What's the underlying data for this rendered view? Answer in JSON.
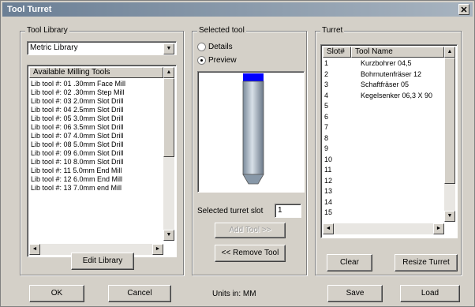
{
  "window": {
    "title": "Tool Turret",
    "close_glyph": "✕"
  },
  "library": {
    "group_title": "Tool Library",
    "selected_library": "Metric Library",
    "list_header": "Available Milling Tools",
    "items": [
      "Lib tool #: 01 .30mm Face Mill",
      "Lib tool #: 02 .30mm Step Mill",
      "Lib tool #: 03 2.0mm Slot Drill",
      "Lib tool #: 04 2.5mm Slot Drill",
      "Lib tool #: 05 3.0mm Slot Drill",
      "Lib tool #: 06 3.5mm Slot Drill",
      "Lib tool #: 07 4.0mm Slot Drill",
      "Lib tool #: 08 5.0mm Slot Drill",
      "Lib tool #: 09 6.0mm Slot Drill",
      "Lib tool #: 10 8.0mm Slot Drill",
      "Lib tool #: 11 5.0mm End Mill",
      "Lib tool #: 12 6.0mm End Mill",
      "Lib tool #: 13 7.0mm end Mill"
    ],
    "edit_button": "Edit Library"
  },
  "selected_tool": {
    "group_title": "Selected tool",
    "option_details": "Details",
    "option_preview": "Preview",
    "selected_option": "Preview",
    "slot_label": "Selected turret slot",
    "slot_value": "1",
    "add_button": "Add Tool >>",
    "remove_button": "<< Remove Tool",
    "preview_cap_color": "#0000ff"
  },
  "turret": {
    "group_title": "Turret",
    "col_slot": "Slot#",
    "col_name": "Tool Name",
    "slots": [
      {
        "slot": "1",
        "name": "Kurzbohrer 04,5"
      },
      {
        "slot": "2",
        "name": "Bohrnutenfräser 12"
      },
      {
        "slot": "3",
        "name": "Schaftfräser 05"
      },
      {
        "slot": "4",
        "name": "Kegelsenker 06,3 X 90"
      },
      {
        "slot": "5",
        "name": ""
      },
      {
        "slot": "6",
        "name": ""
      },
      {
        "slot": "7",
        "name": ""
      },
      {
        "slot": "8",
        "name": ""
      },
      {
        "slot": "9",
        "name": ""
      },
      {
        "slot": "10",
        "name": ""
      },
      {
        "slot": "11",
        "name": ""
      },
      {
        "slot": "12",
        "name": ""
      },
      {
        "slot": "13",
        "name": ""
      },
      {
        "slot": "14",
        "name": ""
      },
      {
        "slot": "15",
        "name": ""
      }
    ],
    "clear_button": "Clear",
    "resize_button": "Resize Turret"
  },
  "footer": {
    "ok_button": "OK",
    "cancel_button": "Cancel",
    "units_text": "Units in: MM",
    "save_button": "Save",
    "load_button": "Load"
  }
}
